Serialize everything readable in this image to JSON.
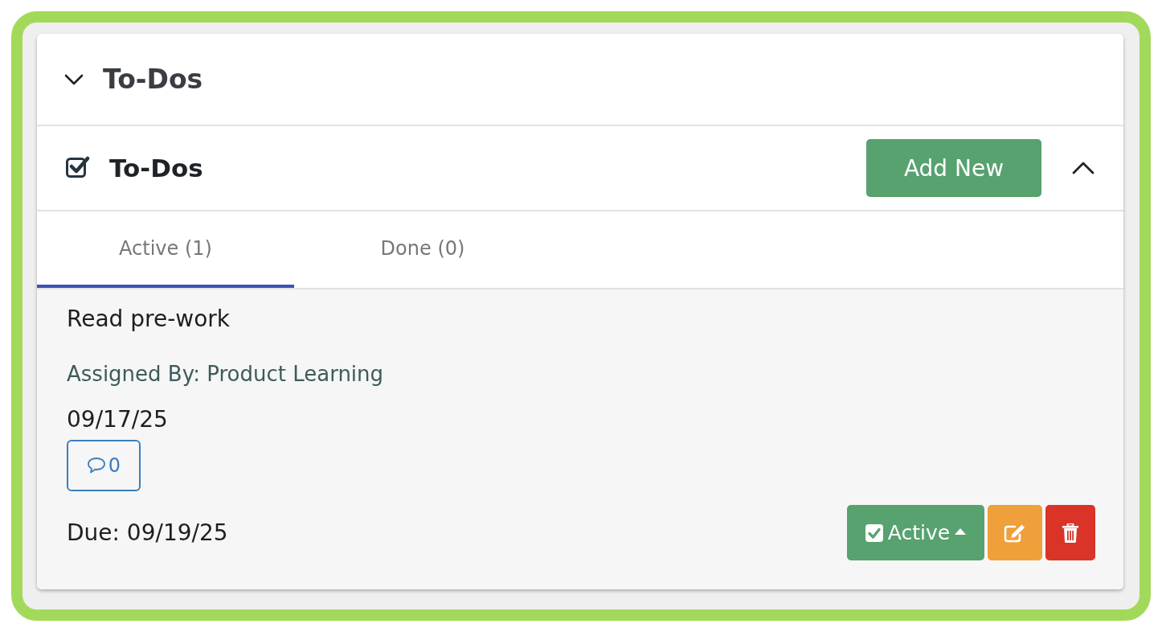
{
  "panel": {
    "title": "To-Dos"
  },
  "section": {
    "title": "To-Dos",
    "add_button": "Add New"
  },
  "tabs": [
    {
      "label": "Active (1)",
      "selected": true
    },
    {
      "label": "Done (0)",
      "selected": false
    }
  ],
  "todos": [
    {
      "title": "Read pre-work",
      "assigned_by": "Assigned By: Product Learning",
      "date": "09/17/25",
      "comments": "0",
      "due": "Due: 09/19/25",
      "status": "Active"
    }
  ]
}
